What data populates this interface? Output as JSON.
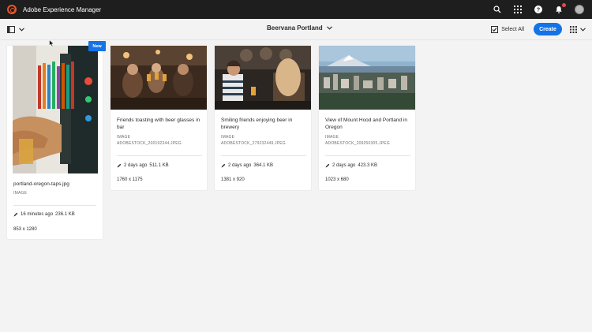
{
  "shell": {
    "app_title": "Adobe Experience Manager",
    "notification_count": "1"
  },
  "actionbar": {
    "folder_title": "Beervana Portland",
    "select_all_label": "Select All",
    "create_label": "Create"
  },
  "colors": {
    "accent": "#1473e6",
    "shell_bg": "#1e1e1e",
    "brand": "#e8562a"
  },
  "assets": [
    {
      "name": "portland-oregon-taps.jpg",
      "type": "IMAGE",
      "modified": "16 minutes ago",
      "size": "236.1 KB",
      "dimensions": "853 x 1280",
      "badge": "New"
    },
    {
      "name": "Friends toasting with beer glasses in bar",
      "type": "IMAGE",
      "stock_id": "ADOBESTOCK_200192344.JPEG",
      "modified": "2 days ago",
      "size": "511.1 KB",
      "dimensions": "1760 x 1175"
    },
    {
      "name": "Smiling friends enjoying beer in brewery",
      "type": "IMAGE",
      "stock_id": "ADOBESTOCK_279232449.JPEG",
      "modified": "2 days ago",
      "size": "364.1 KB",
      "dimensions": "1381 x 920"
    },
    {
      "name": "View of Mount Hood and Portland in Oregon",
      "type": "IMAGE",
      "stock_id": "ADOBESTOCK_209250305.JPEG",
      "modified": "2 days ago",
      "size": "423.3 KB",
      "dimensions": "1023 x 680"
    }
  ]
}
